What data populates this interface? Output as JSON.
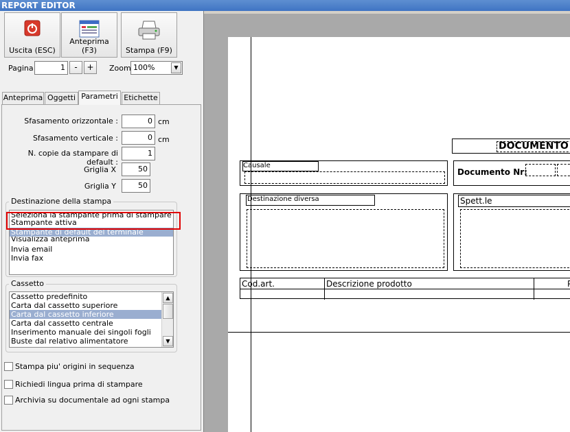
{
  "window": {
    "title": "REPORT EDITOR"
  },
  "toolbar": {
    "exit_label": "Uscita (ESC)",
    "preview_label": "Anteprima (F3)",
    "print_label": "Stampa (F9)"
  },
  "paging": {
    "page_label": "Pagina",
    "page_value": "1",
    "minus_label": "-",
    "plus_label": "+",
    "zoom_label": "Zoom",
    "zoom_value": "100%"
  },
  "tabs": [
    "Anteprima",
    "Oggetti",
    "Parametri",
    "Etichette"
  ],
  "params": {
    "h_offset_label": "Sfasamento orizzontale :",
    "h_offset_value": "0",
    "h_offset_unit": "cm",
    "v_offset_label": "Sfasamento verticale :",
    "v_offset_value": "0",
    "v_offset_unit": "cm",
    "copies_label": "N. copie da stampare di default :",
    "copies_value": "1",
    "grid_x_label": "Griglia X",
    "grid_x_value": "50",
    "grid_y_label": "Griglia Y",
    "grid_y_value": "50"
  },
  "destination": {
    "title": "Destinazione della stampa",
    "items": [
      "Seleziona la stampante prima di stampare",
      "Stampante attiva",
      "Stampante di default del terminale",
      "Visualizza anteprima",
      "Invia email",
      "Invia fax"
    ],
    "selected_index": 2
  },
  "tray": {
    "title": "Cassetto",
    "items": [
      "Cassetto predefinito",
      "Carta dal cassetto superiore",
      "Carta dal cassetto inferiore",
      "Carta dal cassetto centrale",
      "Inserimento manuale dei singoli fogli",
      "Buste dal relativo alimentatore"
    ],
    "selected_index": 2
  },
  "options": [
    "Stampa piu' origini in sequenza",
    "Richiedi lingua prima di stampare",
    "Archivia su documentale ad ogni stampa"
  ],
  "report": {
    "doc_title": "DOCUMENTO",
    "causale": "Causale",
    "doc_number": "Documento Nr:",
    "destinazione": "Destinazione diversa",
    "spett": "Spett.le",
    "col_code": "Cod.art.",
    "col_desc": "Descrizione prodotto",
    "col_extra": "P"
  }
}
